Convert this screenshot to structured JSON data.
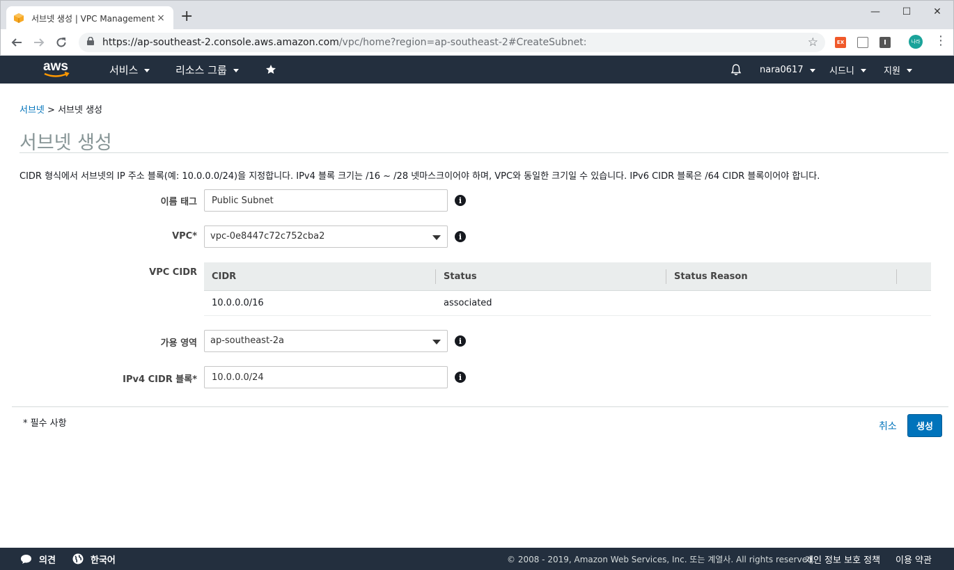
{
  "browser": {
    "tab_title": "서브넷 생성 | VPC Management",
    "tab_close": "×",
    "new_tab": "+",
    "url_host": "https://ap-southeast-2.console.aws.amazon.com",
    "url_path": "/vpc/home?region=ap-southeast-2#CreateSubnet:",
    "ext_ex": "EX",
    "ext_i": "I",
    "profile": "나라",
    "window_controls": [
      "—",
      "☐",
      "✕"
    ]
  },
  "aws_nav": {
    "services": "서비스",
    "resource_groups": "리소스 그룹",
    "user": "nara0617",
    "region": "시드니",
    "support": "지원"
  },
  "breadcrumb": {
    "link": "서브넷",
    "separator": " > ",
    "current": "서브넷 생성"
  },
  "page_title": "서브넷 생성",
  "description": "CIDR 형식에서 서브넷의 IP 주소 블록(예: 10.0.0.0/24)을 지정합니다. IPv4 블록 크기는 /16 ~ /28 넷마스크이어야 하며, VPC와 동일한 크기일 수 있습니다. IPv6 CIDR 블록은 /64 CIDR 블록이어야 합니다.",
  "form": {
    "name_tag_label": "이름 태그",
    "name_tag_value": "Public Subnet",
    "vpc_label": "VPC*",
    "vpc_value": "vpc-0e8447c72c752cba2",
    "vpc_cidr_label": "VPC CIDR",
    "cidr_table": {
      "columns": [
        "CIDR",
        "Status",
        "Status Reason"
      ],
      "rows": [
        {
          "cidr": "10.0.0.0/16",
          "status": "associated",
          "reason": ""
        }
      ]
    },
    "az_label": "가용 영역",
    "az_value": "ap-southeast-2a",
    "ipv4_label": "IPv4 CIDR 블록*",
    "ipv4_value": "10.0.0.0/24",
    "info_glyph": "i"
  },
  "actions": {
    "required_note": "* 필수 사항",
    "cancel": "취소",
    "create": "생성"
  },
  "footer": {
    "feedback": "의견",
    "language": "한국어",
    "copyright": "© 2008 - 2019, Amazon Web Services, Inc. 또는 계열사. All rights reserved.",
    "privacy": "개인 정보 보호 정책",
    "terms": "이용 약관"
  },
  "colors": {
    "aws_nav_bg": "#232f3e",
    "link": "#0073bb",
    "primary_button": "#0073bb",
    "status_ok": "#1d8102",
    "aws_orange": "#ff9900"
  }
}
